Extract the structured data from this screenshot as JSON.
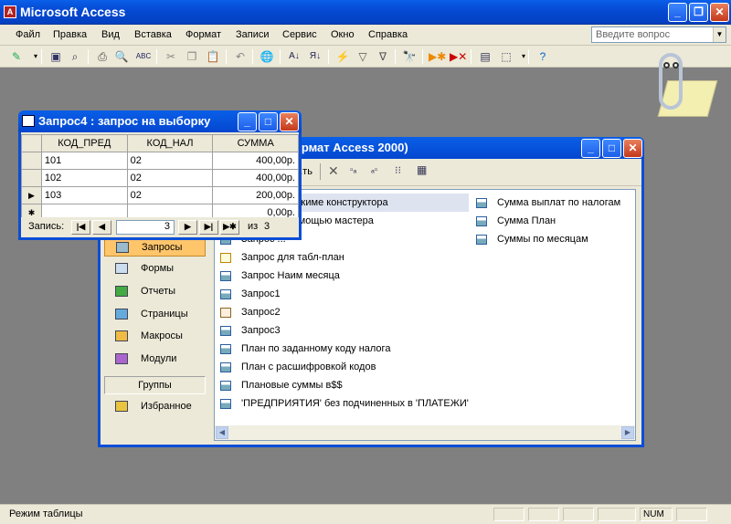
{
  "app": {
    "title": "Microsoft Access"
  },
  "menu": [
    "Файл",
    "Правка",
    "Вид",
    "Вставка",
    "Формат",
    "Записи",
    "Сервис",
    "Окно",
    "Справка"
  ],
  "help_placeholder": "Введите вопрос",
  "status": {
    "mode": "Режим таблицы",
    "num": "NUM"
  },
  "db_window": {
    "title": "...рмат Access 2000)",
    "toolbar_open": "...ть",
    "sidebar": {
      "items": [
        "Запросы",
        "Формы",
        "Отчеты",
        "Страницы",
        "Макросы",
        "Модули"
      ],
      "groups_header": "Группы",
      "favorites": "Избранное"
    },
    "objects_col1": [
      "...проса в режиме конструктора",
      "...проса с помощью мастера",
      "Запрос ...",
      "Запрос для табл-план",
      "Запрос Наим месяца",
      "Запрос1",
      "Запрос2",
      "Запрос3",
      "План по заданному коду налога",
      "План с расшифровкой кодов",
      "Плановые суммы в$$",
      "'ПРЕДПРИЯТИЯ' без подчиненных в 'ПЛАТЕЖИ'"
    ],
    "objects_col2": [
      "Сумма выплат по налогам",
      "Сумма План",
      "Суммы по месяцам"
    ]
  },
  "query_window": {
    "title": "Запрос4 : запрос на выборку",
    "columns": [
      "КОД_ПРЕД",
      "КОД_НАЛ",
      "СУММА"
    ],
    "rows": [
      {
        "marker": "",
        "kod_pred": "101",
        "kod_nal": "02",
        "summa": "400,00р."
      },
      {
        "marker": "",
        "kod_pred": "102",
        "kod_nal": "02",
        "summa": "400,00р."
      },
      {
        "marker": "▶",
        "kod_pred": "103",
        "kod_nal": "02",
        "summa": "200,00р."
      },
      {
        "marker": "✱",
        "kod_pred": "",
        "kod_nal": "",
        "summa": "0,00р."
      }
    ],
    "nav_label": "Запись:",
    "record_number": "3",
    "of_label": "из",
    "record_total": "3"
  }
}
